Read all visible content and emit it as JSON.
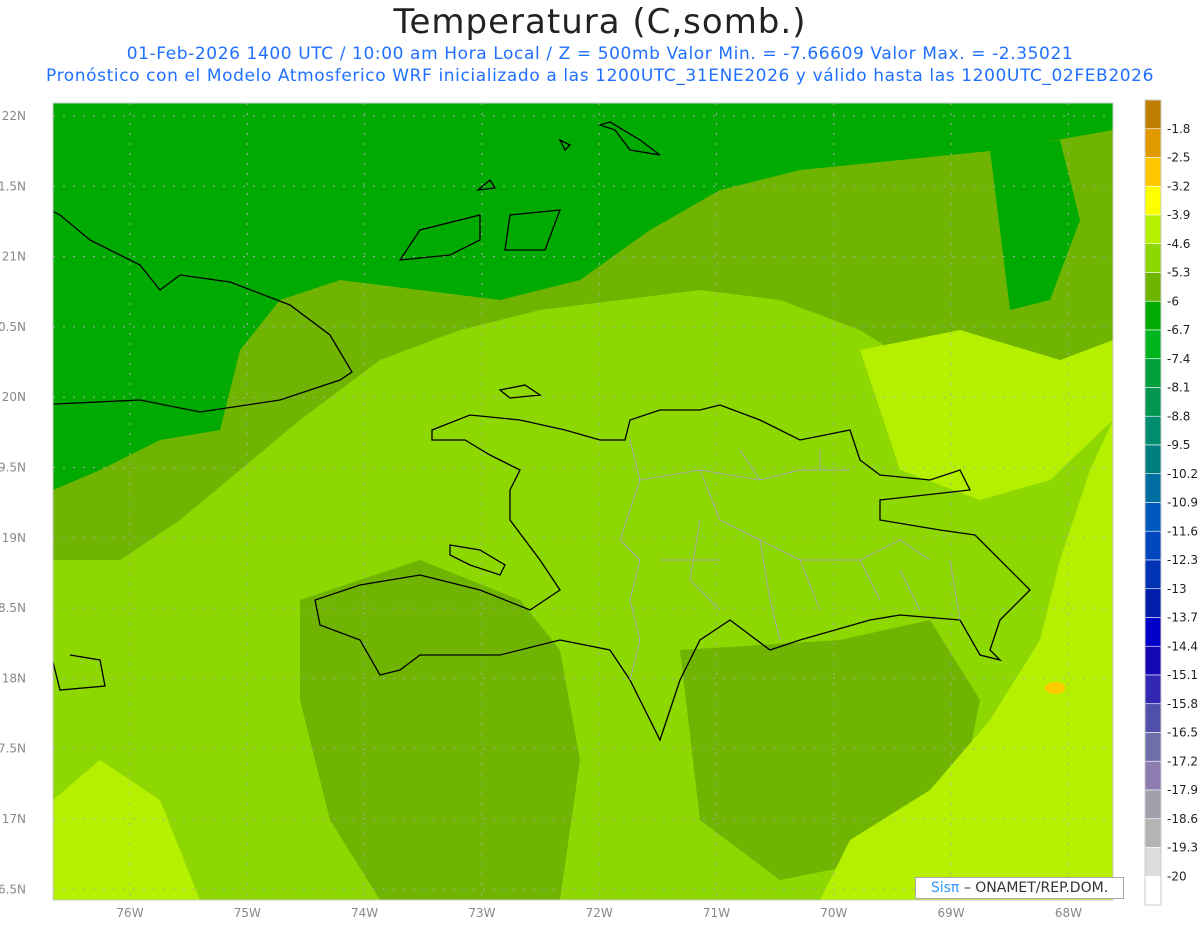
{
  "title": "Temperatura (C,somb.)",
  "subtitle1": "01-Feb-2026  1400 UTC / 10:00 am Hora Local / Z = 500mb  Valor Min. = -7.66609  Valor Max. = -2.35021",
  "subtitle2": "Pronóstico con el Modelo Atmosferico WRF inicializado a las 1200UTC_31ENE2026 y válido hasta las  1200UTC_02FEB2026",
  "credit": {
    "logo": "Sisπ",
    "text": "– ONAMET/REP.DOM."
  },
  "chart_data": {
    "type": "heatmap",
    "title": "Temperatura (C,somb.)",
    "variable": "Temperature at 500mb (C, shaded)",
    "value_min": -7.66609,
    "value_max": -2.35021,
    "x_ticks": [
      "76W",
      "75W",
      "74W",
      "73W",
      "72W",
      "71W",
      "70W",
      "69W",
      "68W"
    ],
    "y_ticks": [
      "22N",
      "1.5N",
      "21N",
      "0.5N",
      "20N",
      "9.5N",
      "19N",
      "8.5N",
      "18N",
      "7.5N",
      "17N",
      "6.5N"
    ],
    "xlim": [
      -76.65,
      -67.6
    ],
    "ylim": [
      16.4,
      22.1
    ],
    "grid": true,
    "colorbar": {
      "placement": "right",
      "labels": [
        "-1.8",
        "-2.5",
        "-3.2",
        "-3.9",
        "-4.6",
        "-5.3",
        "-6",
        "-6.7",
        "-7.4",
        "-8.1",
        "-8.8",
        "-9.5",
        "-10.2",
        "-10.9",
        "-11.6",
        "-12.3",
        "-13",
        "-13.7",
        "-14.4",
        "-15.1",
        "-15.8",
        "-16.5",
        "-17.2",
        "-17.9",
        "-18.6",
        "-19.3",
        "-20"
      ],
      "colors": [
        "#c07e00",
        "#e09a00",
        "#ffc800",
        "#ffff00",
        "#b4f000",
        "#8cd800",
        "#6eb400",
        "#00aa00",
        "#00b41e",
        "#00a03c",
        "#009650",
        "#008c6e",
        "#007f80",
        "#006ea0",
        "#005abe",
        "#0046be",
        "#0032b4",
        "#001eaa",
        "#0000c8",
        "#1408b4",
        "#3228b4",
        "#5050aa",
        "#6e6eaa",
        "#8c7cb0",
        "#a0a0aa",
        "#b4b4b4",
        "#dcdcdc",
        "#ffffff"
      ]
    }
  }
}
